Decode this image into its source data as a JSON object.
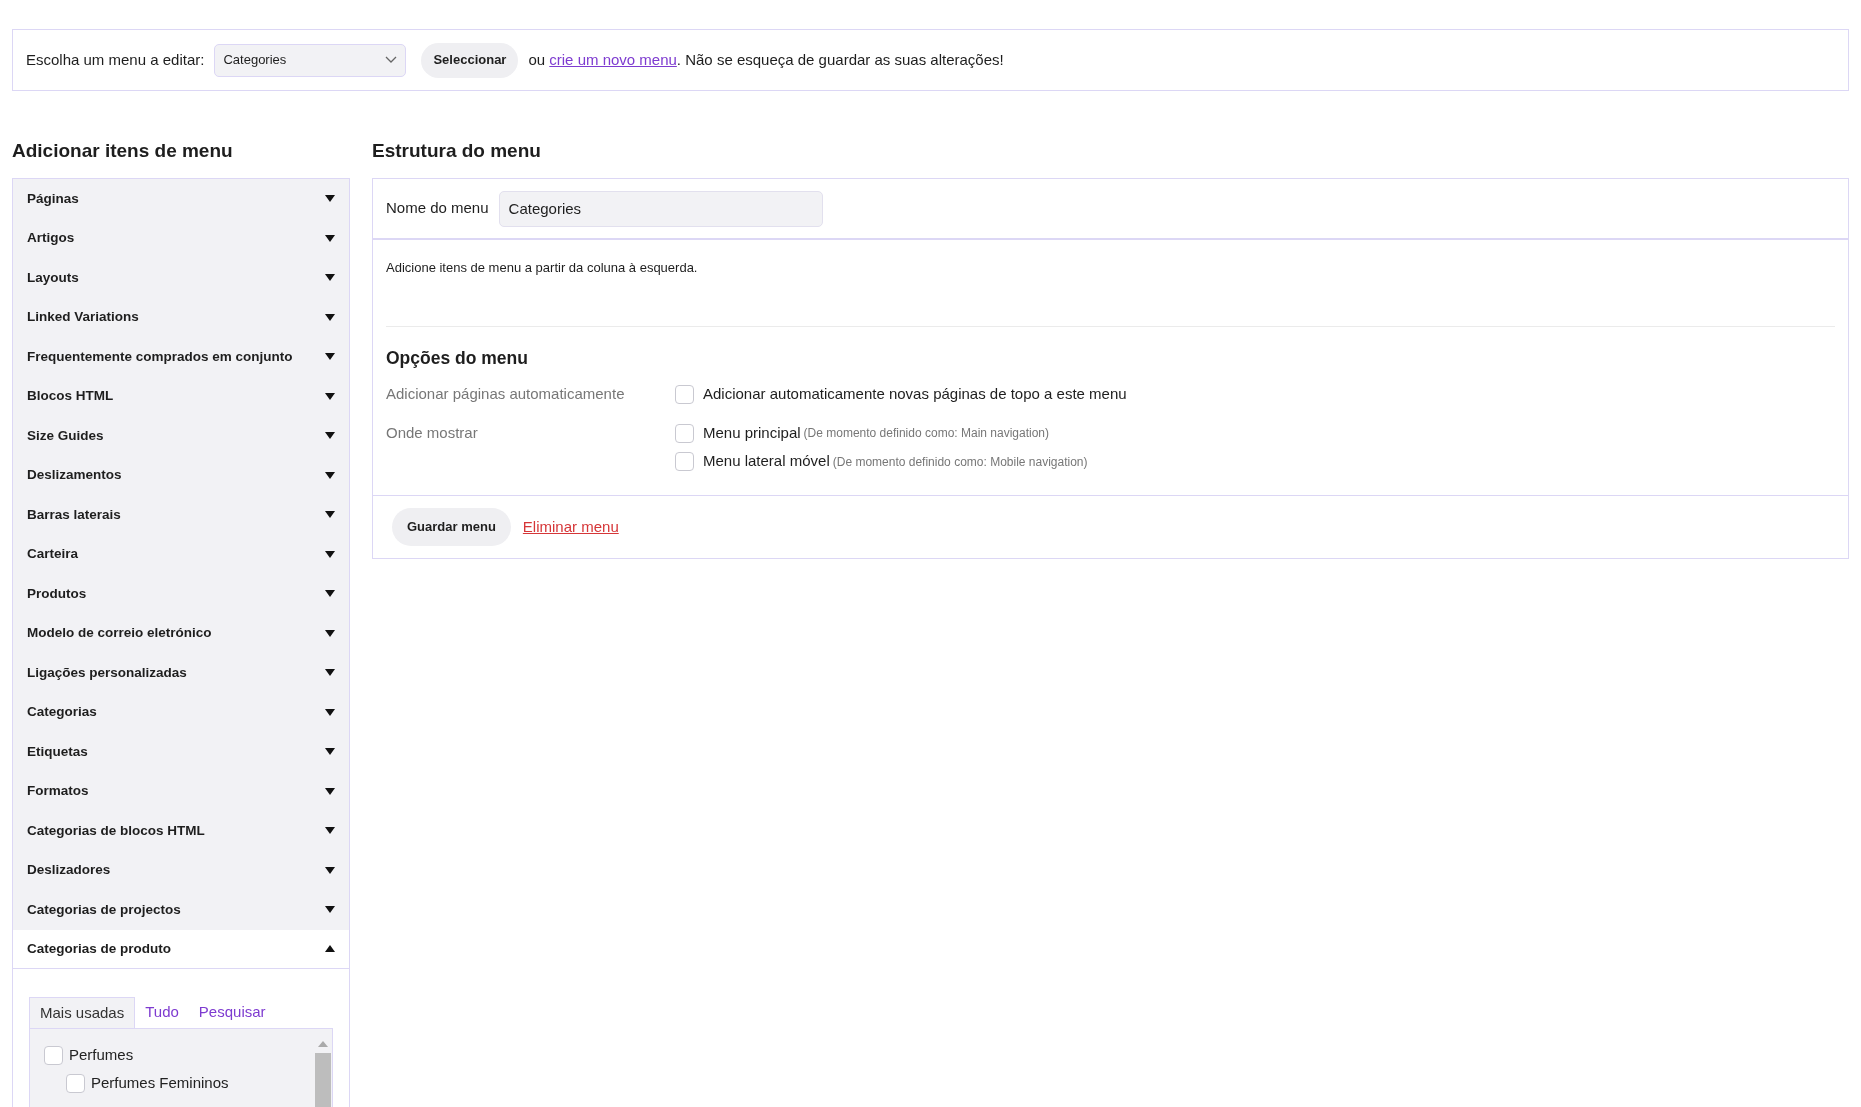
{
  "menu_select": {
    "label": "Escolha um menu a editar:",
    "value": "Categories",
    "button": "Seleccionar",
    "text_before_link": "ou",
    "link": "crie um novo menu",
    "text_after_link": ". Não se esqueça de guardar as suas alterações!"
  },
  "add_items": {
    "title": "Adicionar itens de menu",
    "sections": [
      {
        "label": "Páginas",
        "expanded": false
      },
      {
        "label": "Artigos",
        "expanded": false
      },
      {
        "label": "Layouts",
        "expanded": false
      },
      {
        "label": "Linked Variations",
        "expanded": false
      },
      {
        "label": "Frequentemente comprados em conjunto",
        "expanded": false
      },
      {
        "label": "Blocos HTML",
        "expanded": false
      },
      {
        "label": "Size Guides",
        "expanded": false
      },
      {
        "label": "Deslizamentos",
        "expanded": false
      },
      {
        "label": "Barras laterais",
        "expanded": false
      },
      {
        "label": "Carteira",
        "expanded": false
      },
      {
        "label": "Produtos",
        "expanded": false
      },
      {
        "label": "Modelo de correio eletrónico",
        "expanded": false
      },
      {
        "label": "Ligações personalizadas",
        "expanded": false
      },
      {
        "label": "Categorias",
        "expanded": false
      },
      {
        "label": "Etiquetas",
        "expanded": false
      },
      {
        "label": "Formatos",
        "expanded": false
      },
      {
        "label": "Categorias de blocos HTML",
        "expanded": false
      },
      {
        "label": "Deslizadores",
        "expanded": false
      },
      {
        "label": "Categorias de projectos",
        "expanded": false
      },
      {
        "label": "Categorias de produto",
        "expanded": true
      }
    ],
    "tabs": [
      {
        "label": "Mais usadas",
        "selected": true
      },
      {
        "label": "Tudo",
        "selected": false
      },
      {
        "label": "Pesquisar",
        "selected": false
      }
    ],
    "categories": [
      {
        "label": "Perfumes",
        "checked": false,
        "children": [
          {
            "label": "Perfumes Femininos",
            "checked": false
          }
        ]
      }
    ]
  },
  "structure": {
    "title": "Estrutura do menu",
    "name_label": "Nome do menu",
    "name_value": "Categories",
    "hint": "Adicione itens de menu a partir da coluna à esquerda.",
    "options_title": "Opções do menu",
    "options": [
      {
        "label": "Adicionar páginas automaticamente",
        "choices": [
          {
            "label": "Adicionar automaticamente novas páginas de topo a este menu",
            "checked": false
          }
        ]
      },
      {
        "label": "Onde mostrar",
        "choices": [
          {
            "label": "Menu principal",
            "note": "(De momento definido como: Main navigation)",
            "checked": false
          },
          {
            "label": "Menu lateral móvel",
            "note": "(De momento definido como: Mobile navigation)",
            "checked": false
          }
        ]
      }
    ],
    "save_button": "Guardar menu",
    "delete_link": "Eliminar menu"
  }
}
